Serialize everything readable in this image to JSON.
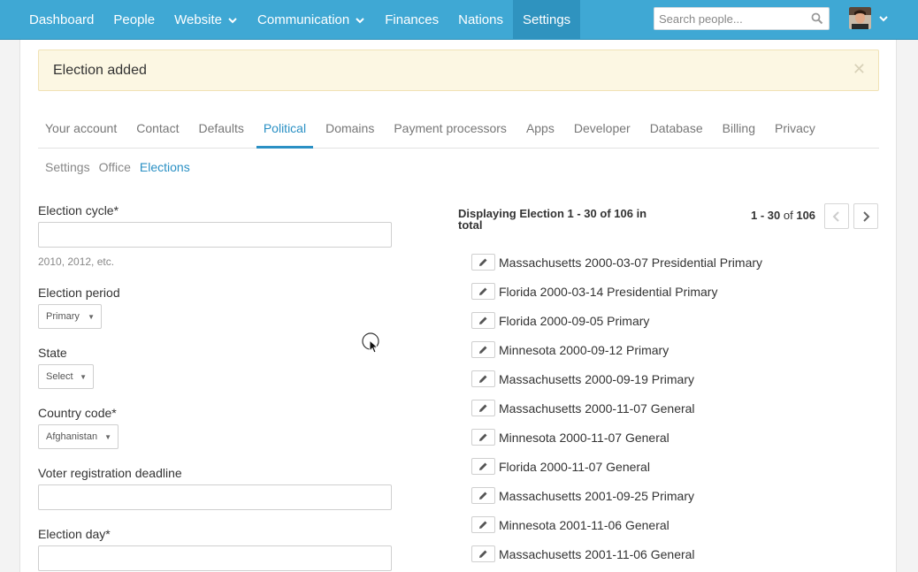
{
  "nav": {
    "items": [
      {
        "label": "Dashboard",
        "has_caret": false,
        "active": false
      },
      {
        "label": "People",
        "has_caret": false,
        "active": false
      },
      {
        "label": "Website",
        "has_caret": true,
        "active": false
      },
      {
        "label": "Communication",
        "has_caret": true,
        "active": false
      },
      {
        "label": "Finances",
        "has_caret": false,
        "active": false
      },
      {
        "label": "Nations",
        "has_caret": false,
        "active": false
      },
      {
        "label": "Settings",
        "has_caret": false,
        "active": true
      }
    ],
    "search_placeholder": "Search people..."
  },
  "flash": {
    "message": "Election added",
    "close_glyph": "✕"
  },
  "tabs": [
    {
      "label": "Your account",
      "active": false
    },
    {
      "label": "Contact",
      "active": false
    },
    {
      "label": "Defaults",
      "active": false
    },
    {
      "label": "Political",
      "active": true
    },
    {
      "label": "Domains",
      "active": false
    },
    {
      "label": "Payment processors",
      "active": false
    },
    {
      "label": "Apps",
      "active": false
    },
    {
      "label": "Developer",
      "active": false
    },
    {
      "label": "Database",
      "active": false
    },
    {
      "label": "Billing",
      "active": false
    },
    {
      "label": "Privacy",
      "active": false
    }
  ],
  "subtabs": [
    {
      "label": "Settings",
      "active": false
    },
    {
      "label": "Office",
      "active": false
    },
    {
      "label": "Elections",
      "active": true
    }
  ],
  "form": {
    "election_cycle_label": "Election cycle*",
    "election_cycle_value": "",
    "election_cycle_help": "2010, 2012, etc.",
    "election_period_label": "Election period",
    "election_period_value": "Primary",
    "state_label": "State",
    "state_value": "Select",
    "country_code_label": "Country code*",
    "country_code_value": "Afghanistan",
    "voter_reg_label": "Voter registration deadline",
    "voter_reg_value": "",
    "election_day_label": "Election day*",
    "election_day_value": ""
  },
  "list": {
    "display_text": "Displaying Election 1 - 30 of 106 in total",
    "page_range": "1 - 30",
    "page_of": "of",
    "page_total": "106",
    "items": [
      "Massachusetts 2000-03-07 Presidential Primary",
      "Florida 2000-03-14 Presidential Primary",
      "Florida 2000-09-05 Primary",
      "Minnesota 2000-09-12 Primary",
      "Massachusetts 2000-09-19 Primary",
      "Massachusetts 2000-11-07 General",
      "Minnesota 2000-11-07 General",
      "Florida 2000-11-07 General",
      "Massachusetts 2001-09-25 Primary",
      "Minnesota 2001-11-06 General",
      "Massachusetts 2001-11-06 General"
    ]
  },
  "colors": {
    "topbar": "#3fa8d4",
    "accent": "#2a90c4",
    "flash_bg": "#fcf7e3"
  }
}
